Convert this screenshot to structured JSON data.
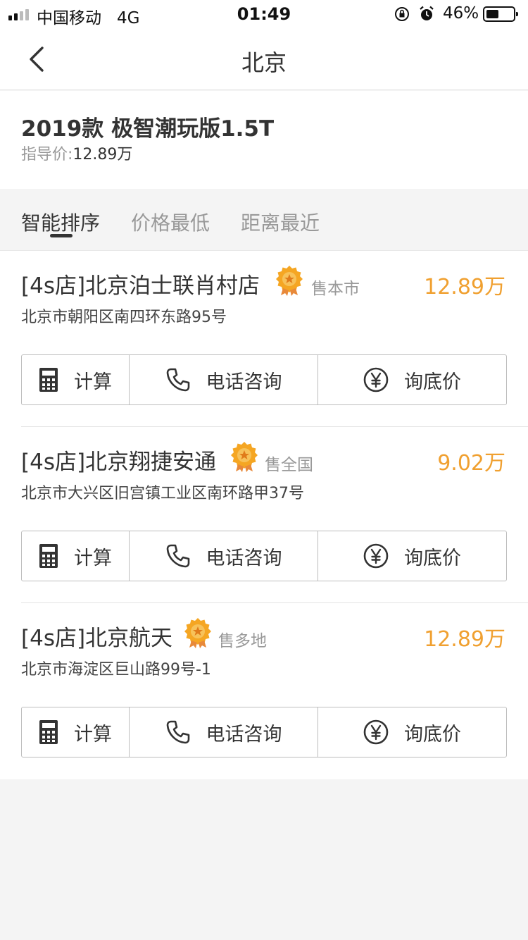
{
  "status_bar": {
    "carrier": "中国移动",
    "network": "4G",
    "time": "01:49",
    "battery_pct": "46%",
    "battery_level": 0.46
  },
  "nav": {
    "title": "北京",
    "back_icon": "chevron-left-icon"
  },
  "model": {
    "name": "2019款 极智潮玩版1.5T",
    "price_label": "指导价:",
    "price_value": "12.89万"
  },
  "tabs": [
    {
      "label": "智能排序",
      "active": true
    },
    {
      "label": "价格最低",
      "active": false
    },
    {
      "label": "距离最近",
      "active": false
    }
  ],
  "dealers": [
    {
      "name": "[4s店]北京泊士联肖村店",
      "sale_scope": "售本市",
      "price": "12.89万",
      "address": "北京市朝阳区南四环东路95号",
      "actions": {
        "calc": "计算",
        "phone": "电话咨询",
        "inquiry": "询底价"
      }
    },
    {
      "name": "[4s店]北京翔捷安通",
      "sale_scope": "售全国",
      "price": "9.02万",
      "address": "北京市大兴区旧宫镇工业区南环路甲37号",
      "actions": {
        "calc": "计算",
        "phone": "电话咨询",
        "inquiry": "询底价"
      }
    },
    {
      "name": "[4s店]北京航天",
      "sale_scope": "售多地",
      "price": "12.89万",
      "address": "北京市海淀区巨山路99号-1",
      "actions": {
        "calc": "计算",
        "phone": "电话咨询",
        "inquiry": "询底价"
      }
    }
  ],
  "icons": {
    "medal": "medal-icon",
    "calculator": "calculator-icon",
    "phone": "phone-icon",
    "yen": "yen-icon"
  },
  "colors": {
    "price": "#f0a030",
    "medal": "#f5a623"
  }
}
